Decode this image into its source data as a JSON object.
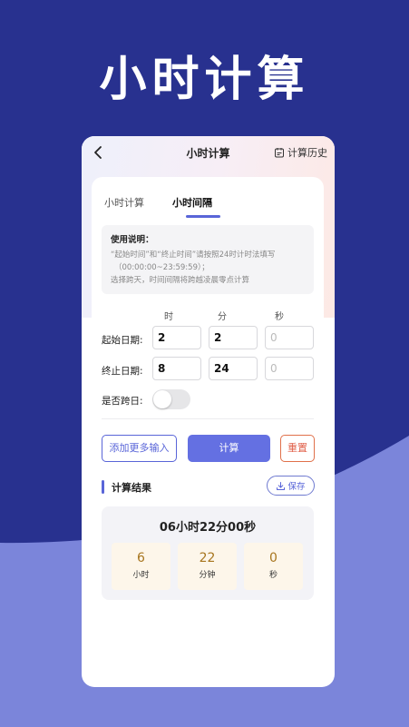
{
  "hero": {
    "title": "小时计算"
  },
  "navbar": {
    "title": "小时计算",
    "history_label": "计算历史"
  },
  "tabs": [
    {
      "label": "小时计算",
      "active": false
    },
    {
      "label": "小时间隔",
      "active": true
    }
  ],
  "instructions": {
    "title": "使用说明：",
    "lines": [
      "“起始时间”和“终止时间”请按照24时计时法填写",
      "（00:00:00~23:59:59）；",
      "选择跨天，时间间隔将跨越凌晨零点计算"
    ]
  },
  "columns": {
    "hour": "时",
    "minute": "分",
    "second": "秒"
  },
  "start": {
    "label": "起始日期:",
    "hour": "2",
    "minute": "2",
    "second_placeholder": "0"
  },
  "end": {
    "label": "终止日期:",
    "hour": "8",
    "minute": "24",
    "second_placeholder": "0"
  },
  "cross_day": {
    "label": "是否跨日:",
    "on": false
  },
  "buttons": {
    "more": "添加更多输入",
    "calculate": "计算",
    "reset": "重置",
    "save": "保存"
  },
  "result": {
    "title": "计算结果",
    "summary": "06小时22分00秒",
    "cells": [
      {
        "value": "6",
        "label": "小时"
      },
      {
        "value": "22",
        "label": "分钟"
      },
      {
        "value": "0",
        "label": "秒"
      }
    ]
  },
  "colors": {
    "background": "#28318f",
    "wave": "#7b85da",
    "accent": "#5965d8",
    "reset": "#e0604a",
    "result_value": "#a7751e"
  }
}
